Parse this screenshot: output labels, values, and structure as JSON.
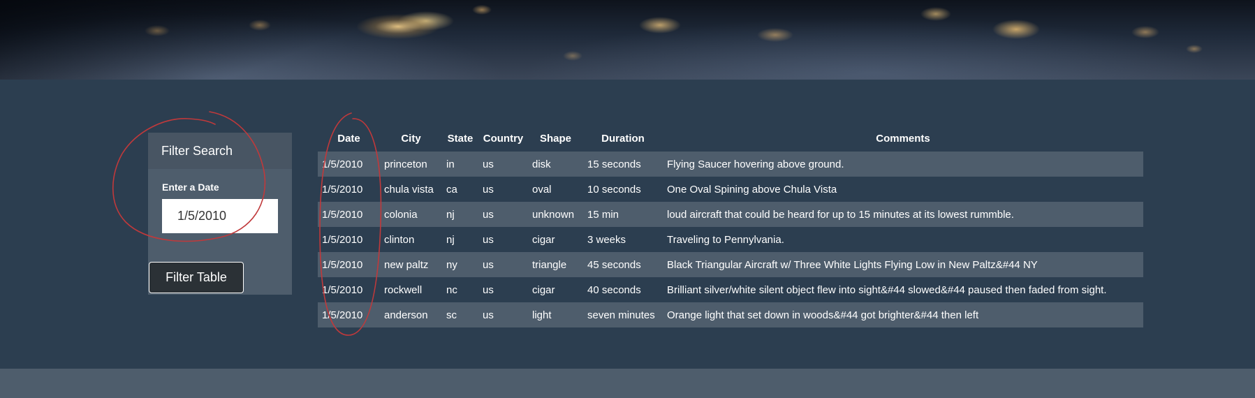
{
  "filter": {
    "heading": "Filter Search",
    "date_label": "Enter a Date",
    "date_value": "1/5/2010",
    "button_label": "Filter Table"
  },
  "table": {
    "columns": [
      "Date",
      "City",
      "State",
      "Country",
      "Shape",
      "Duration",
      "Comments"
    ],
    "rows": [
      [
        "1/5/2010",
        "princeton",
        "in",
        "us",
        "disk",
        "15 seconds",
        "Flying Saucer hovering above ground."
      ],
      [
        "1/5/2010",
        "chula vista",
        "ca",
        "us",
        "oval",
        "10 seconds",
        "One Oval Spining above Chula Vista"
      ],
      [
        "1/5/2010",
        "colonia",
        "nj",
        "us",
        "unknown",
        "15 min",
        "loud aircraft that could be heard for up to 15 minutes at its lowest rummble."
      ],
      [
        "1/5/2010",
        "clinton",
        "nj",
        "us",
        "cigar",
        "3 weeks",
        "Traveling to Pennylvania."
      ],
      [
        "1/5/2010",
        "new paltz",
        "ny",
        "us",
        "triangle",
        "45 seconds",
        "Black Triangular Aircraft w/ Three White Lights Flying Low in New Paltz&#44 NY"
      ],
      [
        "1/5/2010",
        "rockwell",
        "nc",
        "us",
        "cigar",
        "40 seconds",
        "Brilliant silver/white silent object flew into sight&#44 slowed&#44 paused then faded from sight."
      ],
      [
        "1/5/2010",
        "anderson",
        "sc",
        "us",
        "light",
        "seven minutes",
        "Orange light that set down in woods&#44 got brighter&#44 then left"
      ]
    ]
  },
  "colors": {
    "page_background": "#2c3e50",
    "panel_background": "#4e5d6c",
    "annotation_stroke": "#c0393b"
  }
}
